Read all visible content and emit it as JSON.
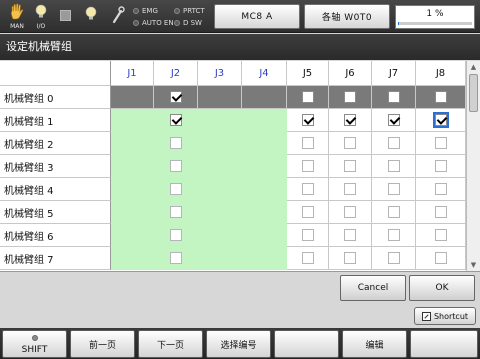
{
  "status": {
    "mode_caption": "MAN",
    "io_caption": "I/O",
    "lamps": [
      "EMG",
      "AUTO EN",
      "PRTCT",
      "D SW"
    ],
    "program_button": "MC8 A",
    "axis_button": "各轴 W0T0",
    "progress_text": "1 %",
    "progress_value": 0.01
  },
  "title": "设定机械臂组",
  "grid": {
    "headers": [
      "J1",
      "J2",
      "J3",
      "J4",
      "J5",
      "J6",
      "J7",
      "J8"
    ],
    "rows": [
      {
        "label": "机械臂组 0",
        "checks": [
          false,
          true,
          false,
          false,
          false,
          false,
          false,
          false
        ]
      },
      {
        "label": "机械臂组 1",
        "checks": [
          false,
          true,
          false,
          false,
          true,
          true,
          true,
          true
        ]
      },
      {
        "label": "机械臂组 2",
        "checks": [
          false,
          false,
          false,
          false,
          false,
          false,
          false,
          false
        ]
      },
      {
        "label": "机械臂组 3",
        "checks": [
          false,
          false,
          false,
          false,
          false,
          false,
          false,
          false
        ]
      },
      {
        "label": "机械臂组 4",
        "checks": [
          false,
          false,
          false,
          false,
          false,
          false,
          false,
          false
        ]
      },
      {
        "label": "机械臂组 5",
        "checks": [
          false,
          false,
          false,
          false,
          false,
          false,
          false,
          false
        ]
      },
      {
        "label": "机械臂组 6",
        "checks": [
          false,
          false,
          false,
          false,
          false,
          false,
          false,
          false
        ]
      },
      {
        "label": "机械臂组 7",
        "checks": [
          false,
          false,
          false,
          false,
          false,
          false,
          false,
          false
        ]
      }
    ]
  },
  "actions": {
    "cancel": "Cancel",
    "ok": "OK"
  },
  "shortcut": "Shortcut",
  "fkeys": [
    "SHIFT",
    "前一页",
    "下一页",
    "选择编号",
    "",
    "编辑",
    ""
  ],
  "colors": {
    "accent": "#2a6fd6",
    "selected_row": "#7a7a7a",
    "enabled_area": "#c3f5c3",
    "header_blue": "#2f3fc5"
  }
}
